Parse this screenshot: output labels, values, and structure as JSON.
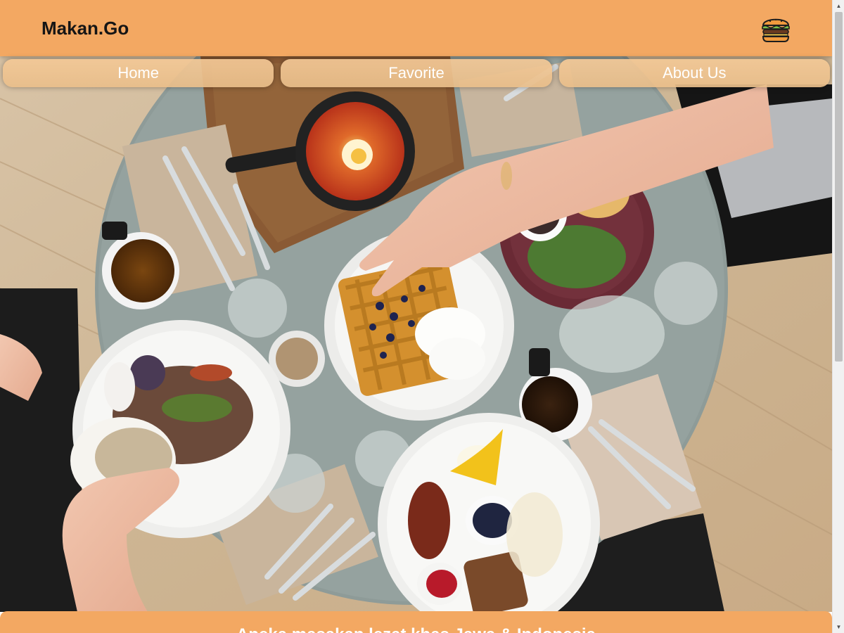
{
  "header": {
    "brand": "Makan.Go",
    "logo_icon": "burger-icon",
    "background_color": "#f3a862"
  },
  "hero": {
    "image_icon": "breakfast-table-photo"
  },
  "nav": {
    "items": [
      {
        "label": "Home"
      },
      {
        "label": "Favorite"
      },
      {
        "label": "About Us"
      }
    ]
  },
  "banner": {
    "text": "Aneka masakan lezat khas Jawa & Indonesia"
  },
  "colors": {
    "accent": "#f3a862",
    "nav_text": "#ffffff",
    "brand_text": "#151515"
  }
}
